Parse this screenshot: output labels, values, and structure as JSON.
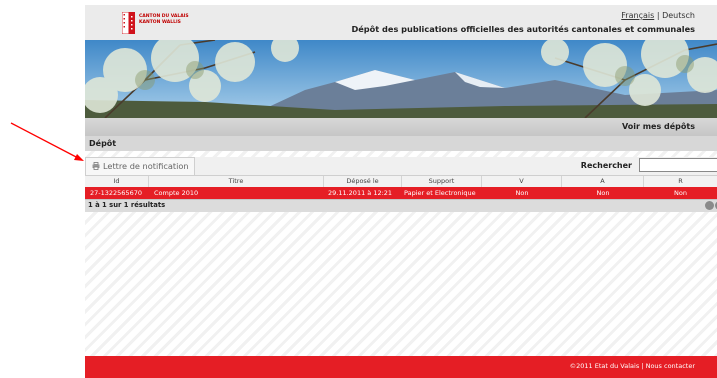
{
  "header": {
    "logo_lines": [
      "CANTON DU VALAIS",
      "KANTON WALLIS"
    ],
    "lang_fr": "Français",
    "lang_sep": "|",
    "lang_de": "Deutsch",
    "site_title": "Dépôt des publications officielles des autorités cantonales et communales"
  },
  "nav": {
    "voir_label": "Voir mes dépôts"
  },
  "section": {
    "title": "Dépôt"
  },
  "toolbar": {
    "lettre_label": "Lettre de notification",
    "search_label": "Rechercher",
    "search_value": ""
  },
  "table": {
    "headers": [
      "Id",
      "Titre",
      "Déposé le",
      "Support",
      "V",
      "A",
      "R"
    ],
    "rows": [
      [
        "27-1322565670",
        "Compte 2010",
        "29.11.2011 à 12:21",
        "Papier et Electronique",
        "Non",
        "Non",
        "Non"
      ]
    ]
  },
  "pager": {
    "summary": "1 à 1 sur 1 résultats"
  },
  "footer": {
    "copyright": "©2011 Etat du Valais",
    "sep": "|",
    "contact": "Nous contacter"
  },
  "colors": {
    "accent_red": "#e51e25",
    "annotation_arrow": "#ff0000"
  }
}
